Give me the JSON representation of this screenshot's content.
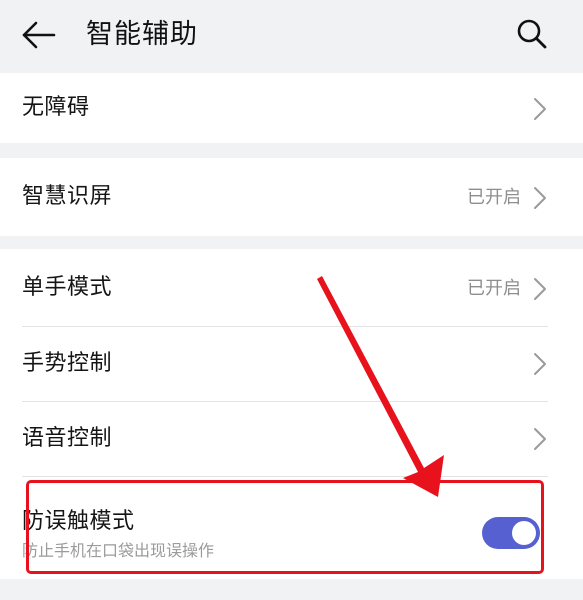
{
  "header": {
    "title": "智能辅助"
  },
  "rows": {
    "accessibility": {
      "label": "无障碍"
    },
    "smart_screen": {
      "label": "智慧识屏",
      "status": "已开启"
    },
    "one_hand": {
      "label": "单手模式",
      "status": "已开启"
    },
    "gesture": {
      "label": "手势控制"
    },
    "voice": {
      "label": "语音控制"
    },
    "anti_touch": {
      "label": "防误触模式",
      "description": "防止手机在口袋出现误操作",
      "enabled": true
    }
  },
  "colors": {
    "accent": "#5660d0",
    "annotation": "#e8121d",
    "background": "#f1f2f4"
  },
  "icons": {
    "back": "arrow-left-icon",
    "search": "search-icon",
    "chevron": "chevron-right-icon"
  }
}
